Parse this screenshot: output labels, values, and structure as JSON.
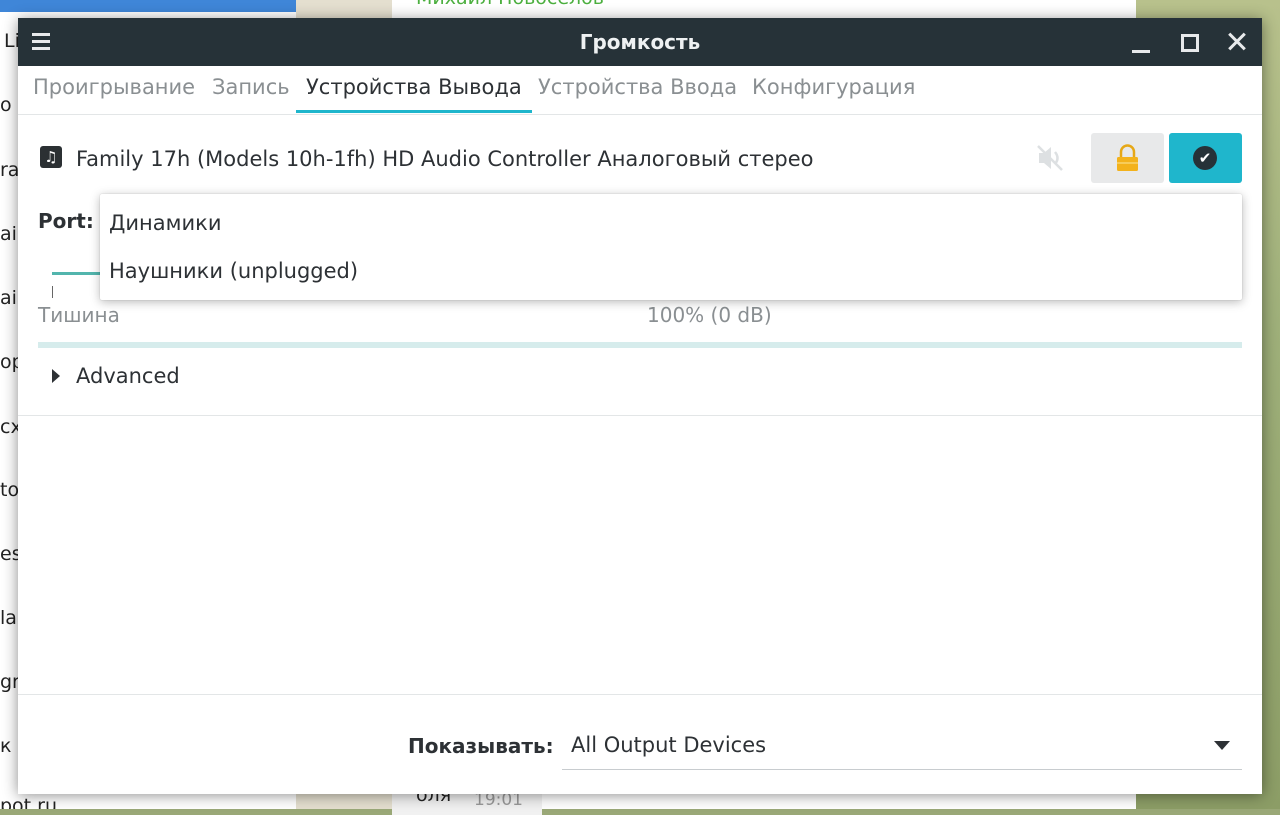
{
  "background": {
    "left_fragments": [
      "Li",
      "о л",
      "ral",
      "ai",
      "ai",
      "op",
      "cx",
      "to",
      "es",
      "la",
      "gra",
      "к",
      "pot.ru"
    ],
    "center_name": "Михаил Новоселов",
    "chat_text": "оля",
    "chat_time": "19:01"
  },
  "window": {
    "title": "Громкость"
  },
  "tabs": [
    {
      "label": "Проигрывание"
    },
    {
      "label": "Запись"
    },
    {
      "label": "Устройства Вывода"
    },
    {
      "label": "Устройства Ввода"
    },
    {
      "label": "Конфигурация"
    }
  ],
  "active_tab": "Устройства Вывода",
  "device": {
    "icon": "music-note-icon",
    "name": "Family 17h (Models 10h-1fh) HD Audio Controller Аналоговый стерео",
    "muted": false,
    "locked": true,
    "is_default": true
  },
  "port": {
    "label": "Port:",
    "options": [
      "Динамики",
      "Наушники (unplugged)"
    ]
  },
  "volume": {
    "min_label": "Тишина",
    "value_label": "100% (0 dB)",
    "level": 1.0
  },
  "advanced": {
    "label": "Advanced",
    "expanded": false
  },
  "footer": {
    "show_label": "Показывать:",
    "show_value": "All Output Devices"
  },
  "colors": {
    "titlebar": "#263238",
    "accent": "#1fb6cc",
    "lock": "#f3b21c"
  }
}
